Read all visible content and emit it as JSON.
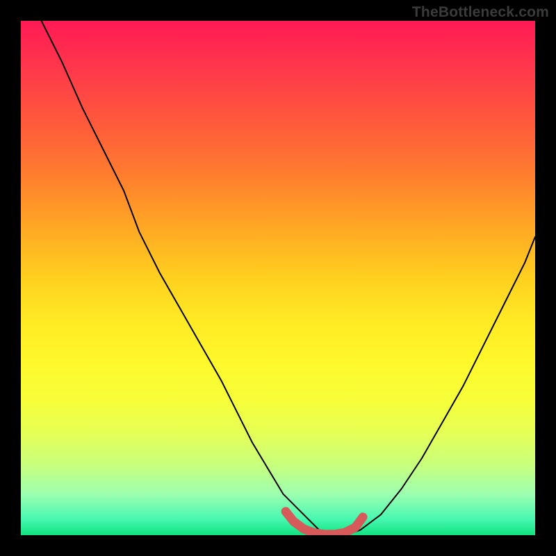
{
  "watermark": "TheBottleneck.com",
  "chart_data": {
    "type": "line",
    "title": "",
    "xlabel": "",
    "ylabel": "",
    "xlim": [
      0,
      100
    ],
    "ylim": [
      0,
      100
    ],
    "grid": false,
    "series": [
      {
        "name": "bottleneck-curve",
        "color": "#000000",
        "thin": true,
        "x": [
          4,
          8,
          12,
          16,
          20,
          23,
          27,
          31,
          35,
          39,
          42,
          45,
          48,
          51,
          55,
          58,
          60,
          63,
          66,
          70,
          74,
          78,
          82,
          86,
          90,
          94,
          98,
          100
        ],
        "y": [
          100,
          92,
          83,
          75,
          67,
          59,
          51,
          44,
          37,
          30,
          24,
          18,
          13,
          8,
          4,
          1,
          0,
          0,
          1,
          4,
          9,
          15,
          22,
          29,
          37,
          45,
          53,
          58
        ]
      },
      {
        "name": "optimal-region",
        "color": "#d65a5a",
        "thick": true,
        "x": [
          51.5,
          53,
          55,
          57,
          59,
          61,
          63,
          65,
          66.5
        ],
        "y": [
          4.6,
          2.7,
          1.2,
          0.45,
          0.15,
          0.15,
          0.5,
          1.5,
          3.5
        ]
      }
    ],
    "background_gradient": {
      "direction": "top-to-bottom",
      "stops": [
        {
          "pos": 0.0,
          "color": "#ff1a55"
        },
        {
          "pos": 0.5,
          "color": "#ffd01f"
        },
        {
          "pos": 0.8,
          "color": "#e6ff55"
        },
        {
          "pos": 1.0,
          "color": "#11e27f"
        }
      ]
    }
  }
}
